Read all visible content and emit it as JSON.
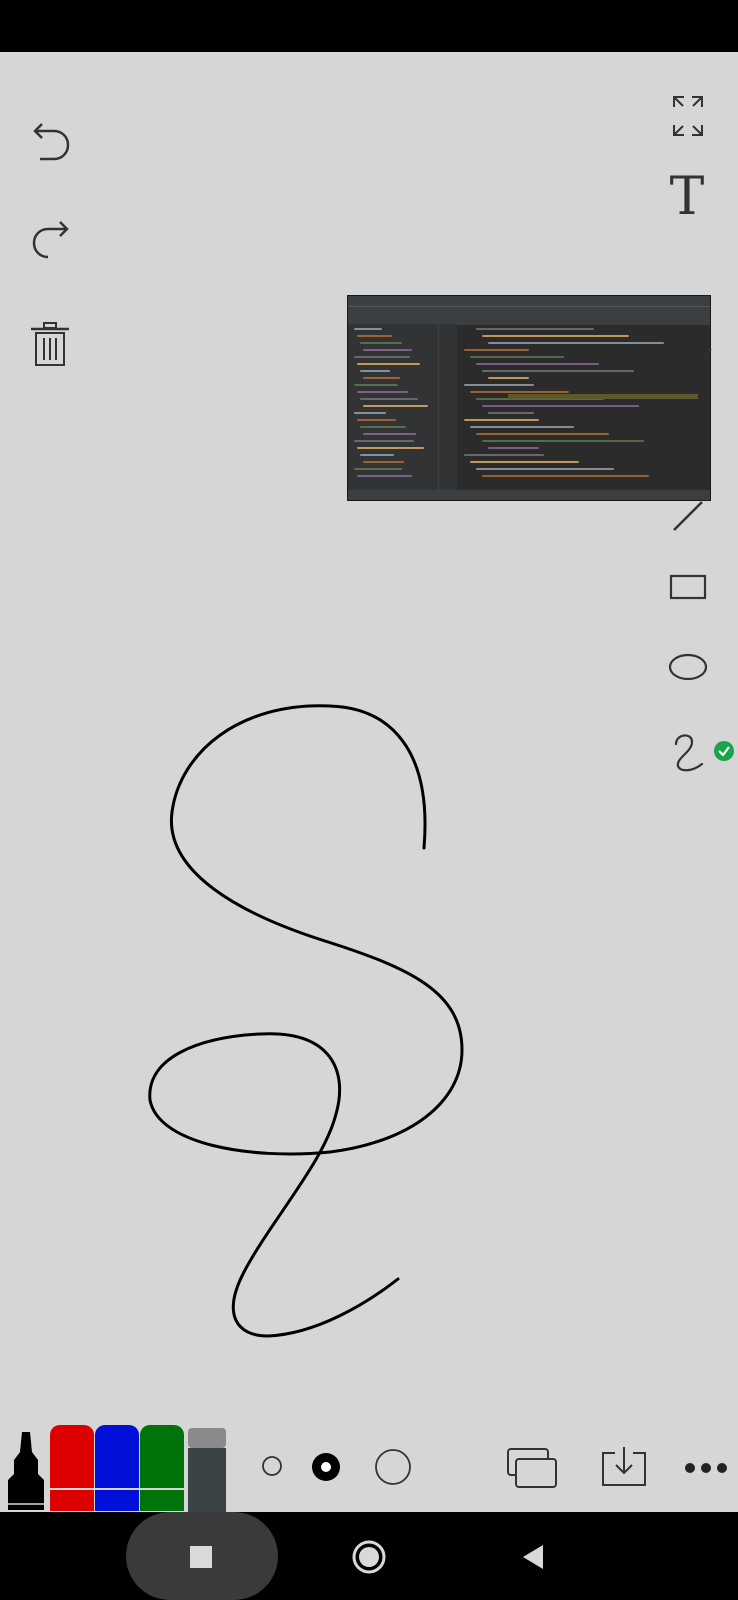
{
  "app": {
    "tools": {
      "undo_icon": "undo-arrow",
      "redo_icon": "redo-arrow",
      "delete_icon": "trash",
      "fullscreen_icon": "expand-arrows",
      "text_tool_label": "T",
      "line_icon": "diagonal-line",
      "rectangle_icon": "rectangle",
      "ellipse_icon": "ellipse",
      "freehand_icon": "squiggle",
      "selected_tool": "freehand"
    },
    "palette": {
      "marker_color": "#000000",
      "colors": [
        "#dd0000",
        "#0010d8",
        "#00730a"
      ],
      "eraser_color": "#3c4345",
      "selected_color": "#000000"
    },
    "brush_sizes": [
      "small",
      "medium",
      "large"
    ],
    "selected_brush_size": "medium",
    "bottom_actions": [
      "layers",
      "save-download",
      "more-options"
    ],
    "inserted_image": "ide-screenshot-thumbnail",
    "accent_color": "#1aa34a"
  }
}
